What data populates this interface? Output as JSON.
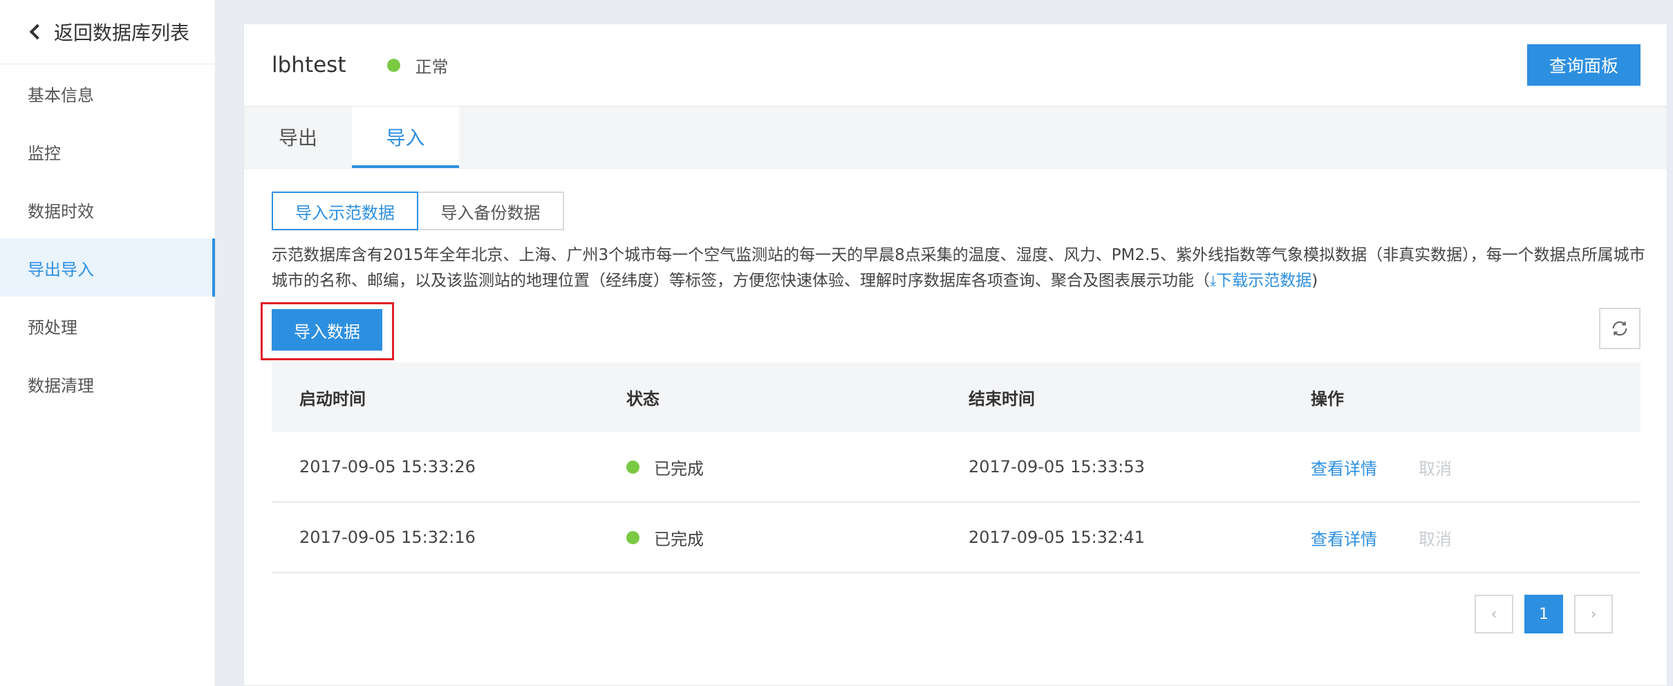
{
  "sidebar": {
    "back_label": "返回数据库列表",
    "items": [
      {
        "label": "基本信息"
      },
      {
        "label": "监控"
      },
      {
        "label": "数据时效"
      },
      {
        "label": "导出导入"
      },
      {
        "label": "预处理"
      },
      {
        "label": "数据清理"
      }
    ],
    "active_index": 3
  },
  "header": {
    "db_name": "lbhtest",
    "status": "正常",
    "status_color": "#7ac943",
    "query_button": "查询面板"
  },
  "tabs": [
    {
      "label": "导出"
    },
    {
      "label": "导入"
    }
  ],
  "active_tab": 1,
  "sub_tabs": [
    {
      "label": "导入示范数据"
    },
    {
      "label": "导入备份数据"
    }
  ],
  "description": {
    "text": "示范数据库含有2015年全年北京、上海、广州3个城市每一个空气监测站的每一天的早晨8点采集的温度、湿度、风力、PM2.5、紫外线指数等气象模拟数据（非真实数据），每一个数据点所属城市城市的名称、邮编，以及该监测站的地理位置（经纬度）等标签，方便您快速体验、理解时序数据库各项查询、聚合及图表展示功能（",
    "link_icon": "download-icon",
    "link_text": "下载示范数据",
    "suffix": ")"
  },
  "import_button": "导入数据",
  "table": {
    "headers": [
      "启动时间",
      "状态",
      "结束时间",
      "操作"
    ],
    "rows": [
      {
        "start": "2017-09-05 15:33:26",
        "status": "已完成",
        "end": "2017-09-05 15:33:53",
        "detail": "查看详情",
        "cancel": "取消"
      },
      {
        "start": "2017-09-05 15:32:16",
        "status": "已完成",
        "end": "2017-09-05 15:32:41",
        "detail": "查看详情",
        "cancel": "取消"
      }
    ]
  },
  "pagination": {
    "prev": "‹",
    "current": "1",
    "next": "›"
  },
  "colors": {
    "accent": "#2d8fe0",
    "success": "#7ac943",
    "highlight_border": "#e0202a"
  }
}
